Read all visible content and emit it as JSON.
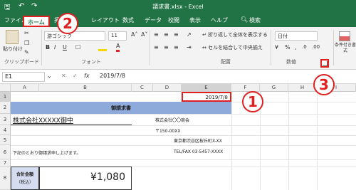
{
  "window": {
    "title": "請求書.xlsx  -  Excel"
  },
  "tabs": [
    {
      "label": "ファイル"
    },
    {
      "label": "ホーム"
    },
    {
      "label": "挿入"
    },
    {
      "label": "レイアウト"
    },
    {
      "label": "数式"
    },
    {
      "label": "データ"
    },
    {
      "label": "校閲"
    },
    {
      "label": "表示"
    },
    {
      "label": "ヘルプ"
    },
    {
      "label": "検索"
    }
  ],
  "ribbon": {
    "paste_label": "貼り付け",
    "clipboard_group": "クリップボード",
    "font_name": "游ゴシック",
    "font_size": "11",
    "font_group": "フォント",
    "wrap_text": "折り返して全体を表示する",
    "merge_center": "セルを結合して中央揃え",
    "alignment_group": "配置",
    "number_format": "日付",
    "number_group": "数値",
    "conditional_format": "条件付き書式"
  },
  "formula_bar": {
    "name_box": "E1",
    "fx": "fx",
    "value": "2019/7/8"
  },
  "columns": [
    "A",
    "B",
    "C",
    "D",
    "E",
    "F",
    "G",
    "H",
    "I"
  ],
  "rows": [
    "1",
    "2",
    "3",
    "4",
    "5",
    "6",
    "7",
    "8"
  ],
  "cells": {
    "e1": "2019/7/8",
    "a2": "御請求書",
    "a3": "株式会社XXXXX御中",
    "d3": "株式会社〇〇商会",
    "d4": "〒150-00XX",
    "d5": "東京都渋谷区桜丘町X-XX",
    "a6": "下記のとおり御請求申し上げます。",
    "d6": "TEL/FAX 03-5457-XXXX",
    "a8_line1": "合計金額",
    "a8_line2": "（税込）",
    "b8": "¥1,080"
  },
  "callouts": {
    "one": "1",
    "two": "2",
    "three": "3"
  },
  "colors": {
    "excel_green": "#217346",
    "highlight_red": "#e02020",
    "header_fill": "#8eaadb",
    "label_fill": "#d6dcef"
  }
}
